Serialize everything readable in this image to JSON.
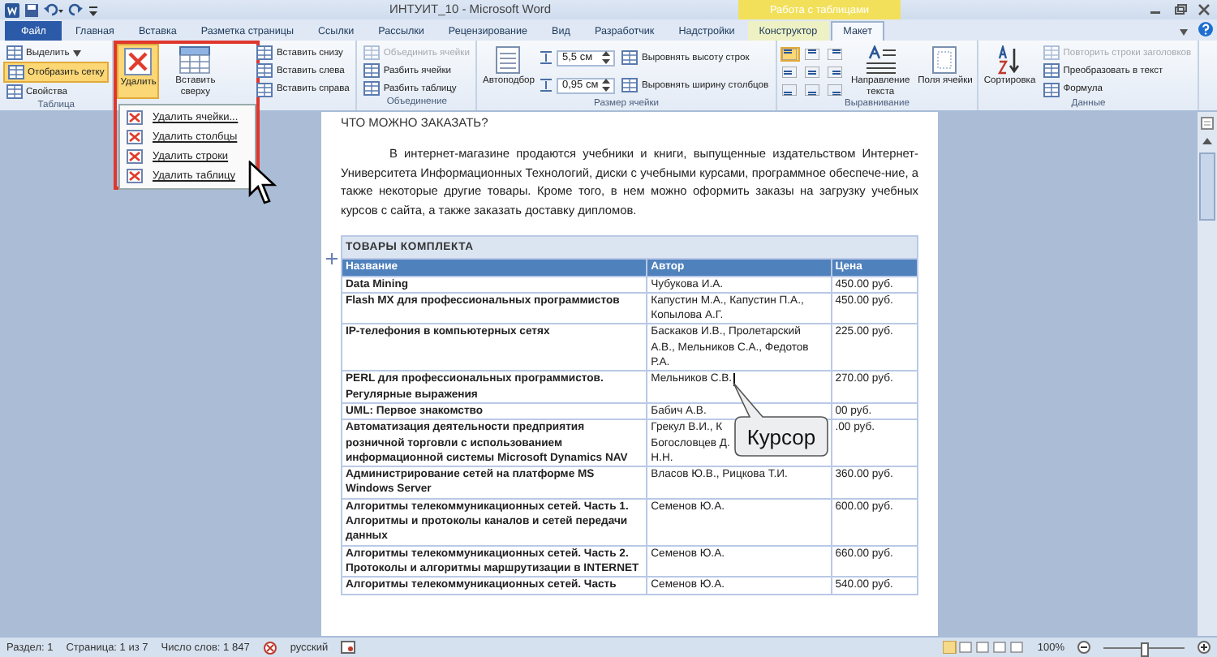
{
  "window": {
    "title": "ИНТУИТ_10 - Microsoft Word",
    "context_group": "Работа с таблицами"
  },
  "tabs": [
    {
      "label": "Файл",
      "kind": "file",
      "selected": false
    },
    {
      "label": "Главная",
      "kind": "normal",
      "selected": false
    },
    {
      "label": "Вставка",
      "kind": "normal",
      "selected": false
    },
    {
      "label": "Разметка страницы",
      "kind": "normal",
      "selected": false
    },
    {
      "label": "Ссылки",
      "kind": "normal",
      "selected": false
    },
    {
      "label": "Рассылки",
      "kind": "normal",
      "selected": false
    },
    {
      "label": "Рецензирование",
      "kind": "normal",
      "selected": false
    },
    {
      "label": "Вид",
      "kind": "normal",
      "selected": false
    },
    {
      "label": "Разработчик",
      "kind": "normal",
      "selected": false
    },
    {
      "label": "Надстройки",
      "kind": "normal",
      "selected": false
    },
    {
      "label": "Конструктор",
      "kind": "context",
      "selected": false
    },
    {
      "label": "Макет",
      "kind": "context",
      "selected": true
    }
  ],
  "ribbon": {
    "groups": [
      {
        "label": "Таблица",
        "columns": [
          [
            {
              "kind": "small",
              "label": "Выделить",
              "dropdown": true,
              "on": false,
              "disabled": false
            },
            {
              "kind": "small",
              "label": "Отобразить сетку",
              "dropdown": false,
              "on": true,
              "disabled": false
            },
            {
              "kind": "small",
              "label": "Свойства",
              "dropdown": false,
              "on": false,
              "disabled": false
            }
          ]
        ]
      },
      {
        "columns": [
          [
            {
              "kind": "delete",
              "label": "Удалить",
              "expanded": true
            }
          ],
          [
            {
              "kind": "insert",
              "label": "Вставить сверху",
              "expanded": false
            }
          ],
          [
            {
              "kind": "small",
              "label": "Вставить снизу",
              "dropdown": false,
              "on": false,
              "disabled": false
            },
            {
              "kind": "small",
              "label": "Вставить слева",
              "dropdown": false,
              "on": false,
              "disabled": false
            },
            {
              "kind": "small",
              "label": "Вставить справа",
              "dropdown": false,
              "on": false,
              "disabled": false
            }
          ]
        ]
      },
      {
        "label": "Объединение",
        "columns": [
          [
            {
              "kind": "small",
              "label": "Объединить ячейки",
              "dropdown": false,
              "on": false,
              "disabled": true
            },
            {
              "kind": "small",
              "label": "Разбить ячейки",
              "dropdown": false,
              "on": false,
              "disabled": false
            },
            {
              "kind": "small",
              "label": "Разбить таблицу",
              "dropdown": false,
              "on": false,
              "disabled": false
            }
          ]
        ]
      },
      {
        "label": "Размер ячейки",
        "columns": [
          [
            {
              "kind": "autofit",
              "label": "Автоподбор",
              "expanded": false
            }
          ],
          [
            {
              "kind": "field",
              "value": "5,5 см"
            },
            {
              "kind": "field",
              "value": "0,95 см"
            }
          ],
          [
            {
              "kind": "small",
              "label": "Выровнять высоту строк",
              "dropdown": false,
              "on": false,
              "disabled": false
            },
            {
              "kind": "small",
              "label": "Выровнять ширину столбцов",
              "dropdown": false,
              "on": false,
              "disabled": false
            }
          ]
        ]
      },
      {
        "label": "Выравнивание",
        "columns": [
          [
            {
              "kind": "align",
              "cells": [
                {
                  "selected": true
                },
                {
                  "selected": false
                },
                {
                  "selected": false
                },
                {
                  "selected": false
                },
                {
                  "selected": false
                },
                {
                  "selected": false
                },
                {
                  "selected": false
                },
                {
                  "selected": false
                },
                {
                  "selected": false
                }
              ]
            }
          ],
          [
            {
              "kind": "direction",
              "label": "Направление текста",
              "expanded": false
            }
          ],
          [
            {
              "kind": "margins",
              "label": "Поля ячейки",
              "expanded": false
            }
          ]
        ]
      },
      {
        "label": "Данные",
        "columns": [
          [
            {
              "kind": "sort",
              "label": "Сортировка",
              "expanded": false
            }
          ],
          [
            {
              "kind": "small",
              "label": "Повторить строки заголовков",
              "dropdown": false,
              "on": false,
              "disabled": true
            },
            {
              "kind": "small",
              "label": "Преобразовать в текст",
              "dropdown": false,
              "on": false,
              "disabled": false
            },
            {
              "kind": "small",
              "label": "Формула",
              "dropdown": false,
              "on": false,
              "disabled": false
            }
          ]
        ]
      }
    ]
  },
  "delete_menu": [
    "Удалить ячейки...",
    "Удалить столбцы",
    "Удалить строки",
    "Удалить таблицу"
  ],
  "document": {
    "heading": "ЧТО МОЖНО ЗАКАЗАТЬ?",
    "paragraph": "В интернет-магазине продаются учебники и книги, выпущенные издательством Интернет-Университета Информационных Технологий, диски с учебными курсами, программное обеспече-ние, а также некоторые другие товары. Кроме того, в нем можно оформить заказы на загрузку учебных курсов с сайта, а также заказать доставку дипломов.",
    "table": {
      "title": "ТОВАРЫ КОМПЛЕКТА",
      "columns": [
        "Название",
        "Автор",
        "Цена"
      ],
      "rows": [
        {
          "cells": [
            "Data Mining",
            "Чубукова И.А.",
            "450.00 руб."
          ],
          "cursor": false
        },
        {
          "cells": [
            "Flash MX для профессиональных программистов",
            "Капустин М.А., Капустин П.А., Копылова А.Г.",
            "450.00 руб."
          ],
          "cursor": false
        },
        {
          "cells": [
            "IP-телефония в компьютерных сетях",
            "Баскаков И.В., Пролетарский А.В., Мельников С.А., Федотов Р.А.",
            "225.00 руб."
          ],
          "cursor": false
        },
        {
          "cells": [
            "PERL для профессиональных программистов. Регулярные выражения",
            "Мельников С.В.",
            "270.00 руб."
          ],
          "cursor": true
        },
        {
          "cells": [
            "UML: Первое знакомство",
            "Бабич А.В.",
            "00 руб."
          ],
          "cursor": false
        },
        {
          "cells": [
            "Автоматизация деятельности предприятия розничной торговли с использованием информационной системы Microsoft Dynamics NAV",
            "Грекул В.И., К\nБогословцев Д.\nН.Н.",
            ".00 руб."
          ],
          "cursor": false
        },
        {
          "cells": [
            "Администрирование сетей на платформе MS Windows Server",
            "Власов Ю.В., Рицкова Т.И.",
            "360.00 руб."
          ],
          "cursor": false
        },
        {
          "cells": [
            "Алгоритмы телекоммуникационных сетей. Часть 1. Алгоритмы и протоколы каналов и сетей передачи данных",
            "Семенов Ю.А.",
            "600.00 руб."
          ],
          "cursor": false
        },
        {
          "cells": [
            "Алгоритмы телекоммуникационных сетей. Часть 2. Протоколы и алгоритмы маршрутизации в INTERNET",
            "Семенов Ю.А.",
            "660.00 руб."
          ],
          "cursor": false
        },
        {
          "cells": [
            "Алгоритмы телекоммуникационных сетей. Часть",
            "Семенов Ю.А.",
            "540.00 руб."
          ],
          "cursor": false
        }
      ]
    },
    "callout": "Курсор"
  },
  "status_bar": {
    "items": [
      "Раздел: 1",
      "Страница: 1 из 7",
      "Число слов: 1 847",
      "русский"
    ],
    "zoom": {
      "reading": "100%",
      "level": 0.5
    }
  }
}
